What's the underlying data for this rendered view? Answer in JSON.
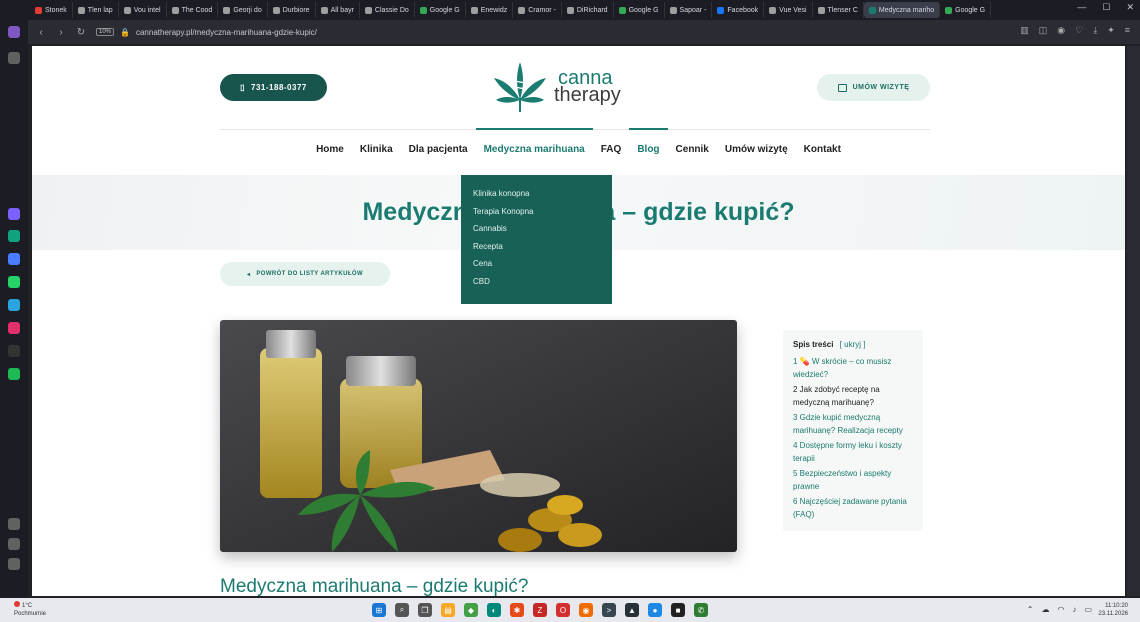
{
  "browser": {
    "tabs": [
      {
        "label": "Stonek",
        "color": "#e53935"
      },
      {
        "label": "Tlen lap",
        "color": "#9e9e9e"
      },
      {
        "label": "Vou intel",
        "color": "#9e9e9e"
      },
      {
        "label": "The Cood",
        "color": "#9e9e9e"
      },
      {
        "label": "Georji do",
        "color": "#9e9e9e"
      },
      {
        "label": "Durbiore",
        "color": "#9e9e9e"
      },
      {
        "label": "All bayr",
        "color": "#9e9e9e"
      },
      {
        "label": "Classie Do",
        "color": "#9e9e9e"
      },
      {
        "label": "Google G",
        "color": "#34a853"
      },
      {
        "label": "Enewidz",
        "color": "#9e9e9e"
      },
      {
        "label": "Cramor -",
        "color": "#9e9e9e"
      },
      {
        "label": "DiRichard",
        "color": "#9e9e9e"
      },
      {
        "label": "Google G",
        "color": "#34a853"
      },
      {
        "label": "Sapoar -",
        "color": "#9e9e9e"
      },
      {
        "label": "Facebook",
        "color": "#1877f2"
      },
      {
        "label": "Vue Vesi",
        "color": "#9e9e9e"
      },
      {
        "label": "Tlenser C",
        "color": "#9e9e9e"
      },
      {
        "label": "Medyczna mariho",
        "color": "#1b7b70"
      },
      {
        "label": "Google G",
        "color": "#34a853"
      }
    ],
    "active_tab_index": 17,
    "url": "cannatherapy.pl/medyczna-marihuana-gdzie-kupic/",
    "shield_badge": "10%",
    "window_controls": [
      "—",
      "☐",
      "✕"
    ]
  },
  "header": {
    "phone": "731-188-0377",
    "logo_line1": "canna",
    "logo_line2": "therapy",
    "book_label": "UMÓW WIZYTĘ"
  },
  "nav": {
    "items": [
      {
        "label": "Home",
        "active": false,
        "teal": false
      },
      {
        "label": "Klinika",
        "active": false,
        "teal": false
      },
      {
        "label": "Dla pacjenta",
        "active": false,
        "teal": false
      },
      {
        "label": "Medyczna marihuana",
        "active": true,
        "teal": true
      },
      {
        "label": "FAQ",
        "active": false,
        "teal": false
      },
      {
        "label": "Blog",
        "active": true,
        "teal": true
      },
      {
        "label": "Cennik",
        "active": false,
        "teal": false
      },
      {
        "label": "Umów wizytę",
        "active": false,
        "teal": false
      },
      {
        "label": "Kontakt",
        "active": false,
        "teal": false
      }
    ]
  },
  "dropdown": {
    "items": [
      "Klinika konopna",
      "Terapia Konopna",
      "Cannabis",
      "Recepta",
      "Cena",
      "CBD"
    ]
  },
  "hero": {
    "title": "Medyczna marihuana – gdzie kupić?"
  },
  "back_button": "POWRÓT DO LISTY ARTYKUŁÓW",
  "toc": {
    "heading": "Spis treści",
    "toggle": "[ ukryj ]",
    "items": [
      {
        "text": "1 💊 W skrócie – co musisz wiedzieć?",
        "dark": false
      },
      {
        "text": "2 Jak zdobyć receptę na medyczną marihuanę?",
        "dark": true
      },
      {
        "text": "3 Gdzie kupić medyczną marihuanę? Realizacja recepty",
        "dark": false
      },
      {
        "text": "4 Dostępne formy leku i koszty terapii",
        "dark": false
      },
      {
        "text": "5 Bezpieczeństwo i aspekty prawne",
        "dark": false
      },
      {
        "text": "6 Najczęściej zadawane pytania (FAQ)",
        "dark": false
      }
    ]
  },
  "article": {
    "title": "Medyczna marihuana – gdzie kupić?"
  },
  "taskbar": {
    "weather_temp": "1°C",
    "weather_desc": "Pochmurnie",
    "time": "11:10:20",
    "date": "23.11.2026",
    "icons": [
      {
        "name": "windows-start-icon",
        "color": "#1976d2",
        "glyph": "⊞"
      },
      {
        "name": "search-icon",
        "color": "#555555",
        "glyph": "⌕"
      },
      {
        "name": "task-view-icon",
        "color": "#555555",
        "glyph": "❐"
      },
      {
        "name": "file-explorer-icon",
        "color": "#f9a825",
        "glyph": "▤"
      },
      {
        "name": "store-icon",
        "color": "#43a047",
        "glyph": "◆"
      },
      {
        "name": "edge-icon",
        "color": "#00897b",
        "glyph": "◐"
      },
      {
        "name": "app-icon",
        "color": "#e64a19",
        "glyph": "✱"
      },
      {
        "name": "filezilla-icon",
        "color": "#c62828",
        "glyph": "Z"
      },
      {
        "name": "opera-icon",
        "color": "#d32f2f",
        "glyph": "O"
      },
      {
        "name": "firefox-icon",
        "color": "#ef6c00",
        "glyph": "◉"
      },
      {
        "name": "terminal-icon",
        "color": "#37474f",
        "glyph": ">"
      },
      {
        "name": "image-app-icon",
        "color": "#263238",
        "glyph": "▲"
      },
      {
        "name": "browser-icon",
        "color": "#1e88e5",
        "glyph": "●"
      },
      {
        "name": "app-dark-icon",
        "color": "#212121",
        "glyph": "■"
      },
      {
        "name": "whatsapp-icon",
        "color": "#2e7d32",
        "glyph": "✆"
      }
    ]
  },
  "sidebar_icons": [
    {
      "name": "home-icon",
      "color": "#7e57c2"
    },
    {
      "name": "pin-icon",
      "color": "#616161"
    },
    {
      "name": "photos-icon",
      "color": "#7b61ff"
    },
    {
      "name": "chatgpt-icon",
      "color": "#10a37f"
    },
    {
      "name": "messenger-icon",
      "color": "#4a7cff"
    },
    {
      "name": "whatsapp-icon",
      "color": "#25d366"
    },
    {
      "name": "telegram-icon",
      "color": "#2aa3df"
    },
    {
      "name": "instagram-icon",
      "color": "#e1306c"
    },
    {
      "name": "x-icon",
      "color": "#333333"
    },
    {
      "name": "spotify-icon",
      "color": "#1db954"
    },
    {
      "name": "heart-icon",
      "color": "#616161"
    },
    {
      "name": "clock-icon",
      "color": "#616161"
    },
    {
      "name": "settings-icon",
      "color": "#616161"
    }
  ]
}
